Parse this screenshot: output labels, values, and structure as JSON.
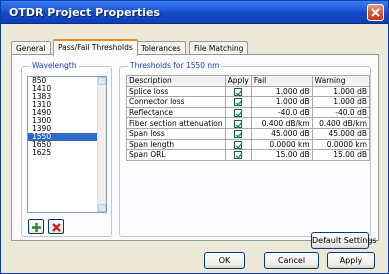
{
  "window": {
    "title": "OTDR Project Properties"
  },
  "tabs": [
    {
      "label": "General"
    },
    {
      "label": "Pass/Fail Thresholds"
    },
    {
      "label": "Tolerances"
    },
    {
      "label": "File Matching"
    }
  ],
  "wavelength": {
    "label": "Wavelength",
    "items": [
      "850",
      "1410",
      "1383",
      "1310",
      "1490",
      "1300",
      "1390",
      "1550",
      "1650",
      "1625"
    ],
    "selected": "1550"
  },
  "thresholds": {
    "label": "Thresholds for 1550 nm",
    "columns": [
      "Description",
      "Apply",
      "Fail",
      "Warning"
    ],
    "rows": [
      {
        "description": "Splice loss",
        "apply": true,
        "fail": "1.000 dB",
        "warning": "1.000 dB"
      },
      {
        "description": "Connector loss",
        "apply": true,
        "fail": "1.000 dB",
        "warning": "1.000 dB"
      },
      {
        "description": "Reflectance",
        "apply": true,
        "fail": "-40.0 dB",
        "warning": "-40.0 dB"
      },
      {
        "description": "Fiber section attenuation",
        "apply": true,
        "fail": "0.400 dB/km",
        "warning": "0.400 dB/km"
      },
      {
        "description": "Span loss",
        "apply": true,
        "fail": "45.000 dB",
        "warning": "45.000 dB"
      },
      {
        "description": "Span length",
        "apply": true,
        "fail": "0.0000 km",
        "warning": "0.0000 km"
      },
      {
        "description": "Span ORL",
        "apply": true,
        "fail": "15.00 dB",
        "warning": "15.00 dB"
      }
    ],
    "default_button": "Default Settings"
  },
  "footer": {
    "ok": "OK",
    "cancel": "Cancel",
    "apply": "Apply"
  }
}
